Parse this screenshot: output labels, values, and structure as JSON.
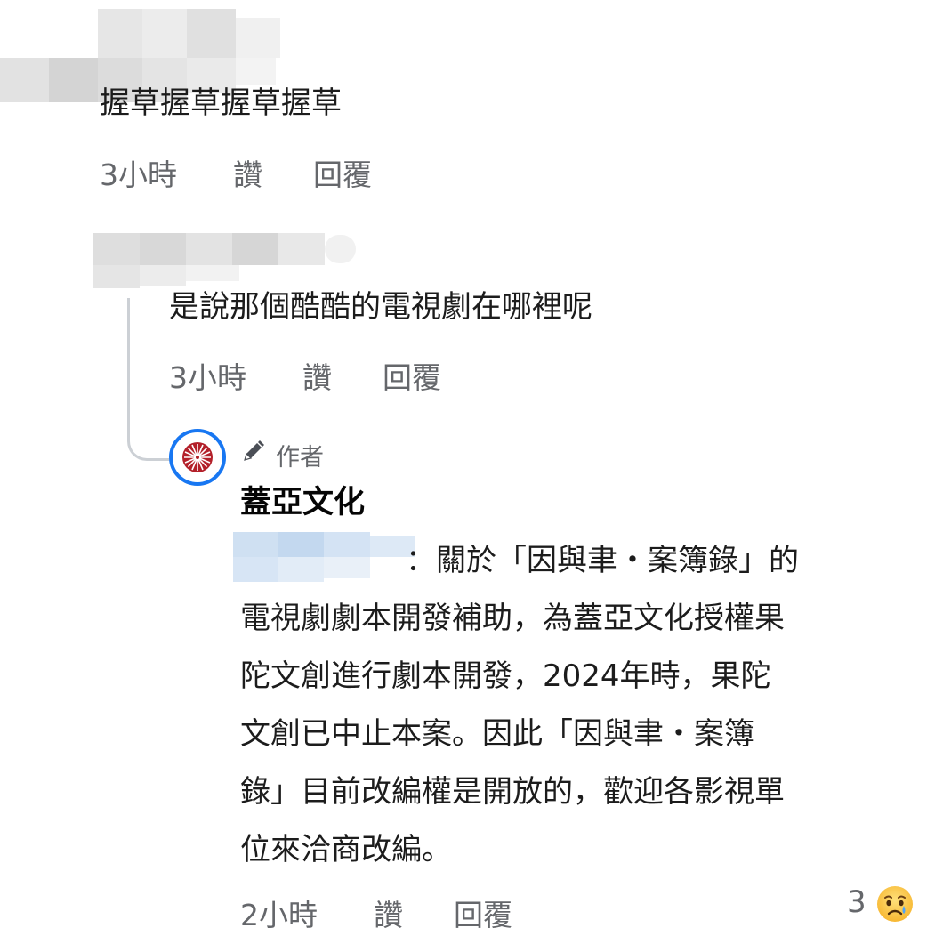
{
  "comments": [
    {
      "text": "握草握草握草握草",
      "time": "3小時",
      "like_label": "讚",
      "reply_label": "回覆"
    },
    {
      "text": "是說那個酷酷的電視劇在哪裡呢",
      "time": "3小時",
      "like_label": "讚",
      "reply_label": "回覆"
    },
    {
      "author_badge": "作者",
      "author_name": "蓋亞文化",
      "lines": [
        "：關於「因與聿・案簿錄」的",
        "電視劇劇本開發補助，為蓋亞文化授權果",
        "陀文創進行劇本開發，2024年時，果陀",
        "文創已中止本案。因此「因與聿・案簿",
        "錄」目前改編權是開放的，歡迎各影視單",
        "位來洽商改編。"
      ],
      "time": "2小時",
      "like_label": "讚",
      "reply_label": "回覆",
      "reaction_count": "3",
      "reaction_icon": "crying-face-icon"
    }
  ],
  "colors": {
    "meta_gray": "#65676b",
    "thread_line": "#ccd0d5",
    "avatar_ring": "#1877f2",
    "avatar_red": "#b3202a"
  }
}
